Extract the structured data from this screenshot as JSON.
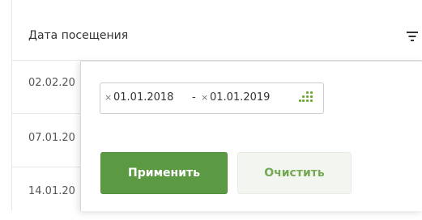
{
  "table": {
    "header_label": "Дата посещения",
    "filter_icon": "filter-icon",
    "rows": [
      {
        "date": "02.02.20"
      },
      {
        "date": "07.01.20"
      },
      {
        "date": "14.01.20"
      }
    ]
  },
  "filter_popup": {
    "from_clear": "×",
    "from_date": "01.01.2018",
    "separator": "-",
    "to_clear": "×",
    "to_date": "01.01.2019",
    "calendar_icon": "calendar-grid-icon",
    "apply_label": "Применить",
    "clear_label": "Очистить"
  },
  "colors": {
    "accent_green": "#5b9a43",
    "clear_text_green": "#75a956",
    "icon_green": "#6aaa2e"
  }
}
